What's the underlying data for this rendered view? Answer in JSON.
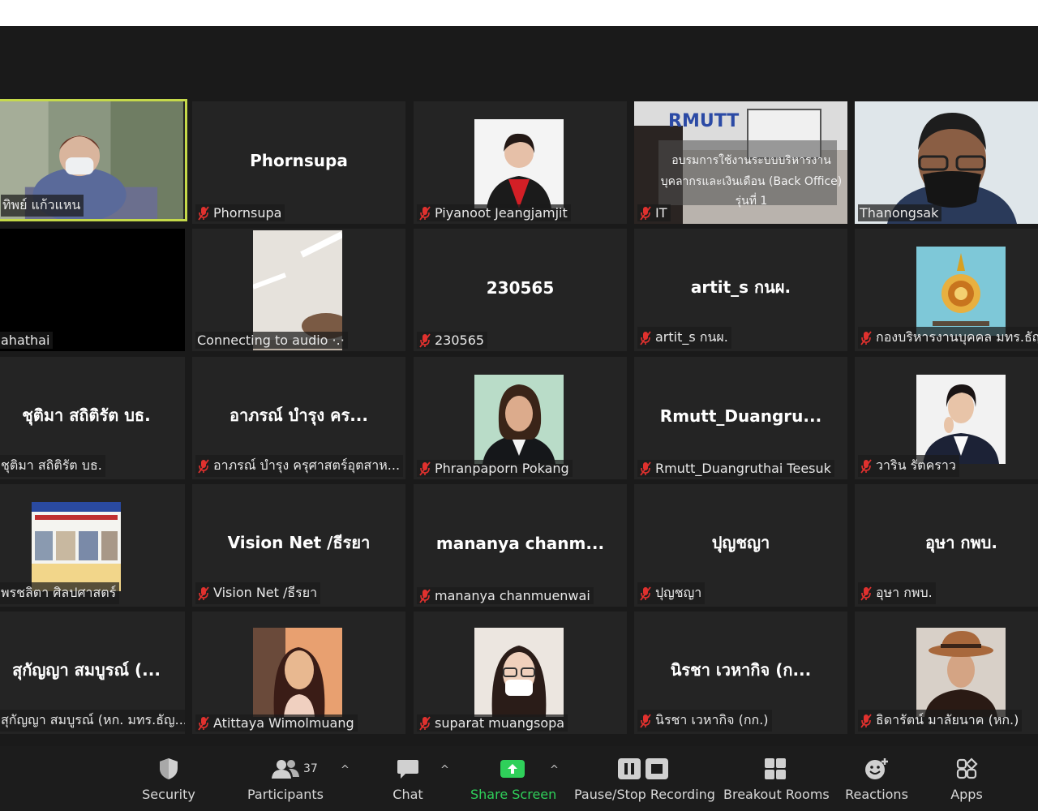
{
  "participants": {
    "r1c1": {
      "label": "ทิพย์ แก้วแหน"
    },
    "r1c2": {
      "big": "Phornsupa",
      "label": "Phornsupa"
    },
    "r1c3": {
      "label": "Piyanoot Jeangjamjit"
    },
    "r1c4": {
      "label": "IT",
      "slide": {
        "logo": "RMUTT",
        "line1": "อบรมการใช้งานระบบบริหารงาน",
        "line2": "บุคลากรและเงินเดือน (Back Office)",
        "line3": "รุ่นที่ 1"
      }
    },
    "r1c5": {
      "label": "Thanongsak"
    },
    "r2c1": {
      "label": "ahathai"
    },
    "r2c2": {
      "label": "Connecting to audio ·.·"
    },
    "r2c3": {
      "big": "230565",
      "label": "230565"
    },
    "r2c4": {
      "big": "artit_s กนผ.",
      "label": "artit_s กนผ."
    },
    "r2c5": {
      "label": "กองบริหารงานบุคคล มทร.ธัญ"
    },
    "r3c1": {
      "big": "ชุติมา  สถิติรัต  บธ.",
      "label": "ชุติมา  สถิติรัต  บธ."
    },
    "r3c2": {
      "big": "อาภรณ์ บำรุง คร...",
      "label": "อาภรณ์ บำรุง ครุศาสตร์อุตสาห..."
    },
    "r3c3": {
      "label": "Phranpaporn Pokang"
    },
    "r3c4": {
      "big": "Rmutt_Duangru...",
      "label": "Rmutt_Duangruthai Teesuk"
    },
    "r3c5": {
      "label": "วาริน รัตคราว"
    },
    "r4c1": {
      "label": "พรชลิตา ศิลปศาสตร์"
    },
    "r4c2": {
      "big": "Vision Net /ธีรยา",
      "label": "Vision Net /ธีรยา"
    },
    "r4c3": {
      "big": "mananya  chanm...",
      "label": "mananya chanmuenwai"
    },
    "r4c4": {
      "big": "ปุญชญา",
      "label": "ปุญชญา"
    },
    "r4c5": {
      "big": "อุษา กพบ.",
      "label": "อุษา กพบ."
    },
    "r5c1": {
      "big": "สุกัญญา สมบูรณ์ (...",
      "label": "สุกัญญา สมบูรณ์ (หก. มทร.ธัญ..."
    },
    "r5c2": {
      "label": "Atittaya Wimolmuang"
    },
    "r5c3": {
      "label": "suparat muangsopa"
    },
    "r5c4": {
      "big": "นิรชา  เวหากิจ (ก...",
      "label": "นิรชา  เวหากิจ (กก.)"
    },
    "r5c5": {
      "label": "ธิดารัตน์ มาลัยนาค (หก.)"
    }
  },
  "toolbar": {
    "security": "Security",
    "participants": "Participants",
    "participants_count": "37",
    "chat": "Chat",
    "share_screen": "Share Screen",
    "recording": "Pause/Stop Recording",
    "breakout": "Breakout Rooms",
    "reactions": "Reactions",
    "apps": "Apps"
  },
  "colors": {
    "speaking_border": "#c5d94a",
    "share_green": "#2fd05a",
    "muted_red": "#e0312e",
    "tile_bg": "#242424"
  }
}
